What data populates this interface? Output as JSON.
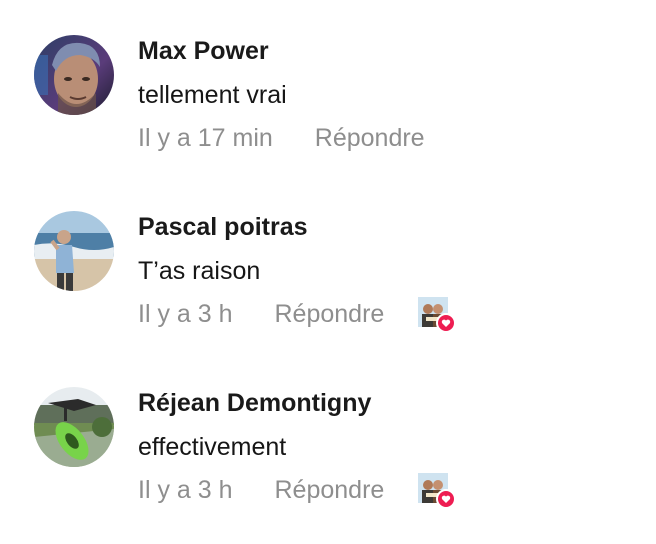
{
  "comments": [
    {
      "author": "Max Power",
      "text": "tellement vrai",
      "time": "Il y a 17 min",
      "reply_label": "Répondre",
      "liked_by_creator": false
    },
    {
      "author": "Pascal poitras",
      "text": "T’as raison",
      "time": "Il y a 3 h",
      "reply_label": "Répondre",
      "liked_by_creator": true
    },
    {
      "author": "Réjean Demontigny",
      "text": "effectivement",
      "time": "Il y a 3 h",
      "reply_label": "Répondre",
      "liked_by_creator": true
    }
  ],
  "colors": {
    "name": "#1a1a1a",
    "meta": "#8e8e8e",
    "heart": "#ee1d52"
  },
  "icons": {
    "creator_like_badge": "heart-icon"
  }
}
